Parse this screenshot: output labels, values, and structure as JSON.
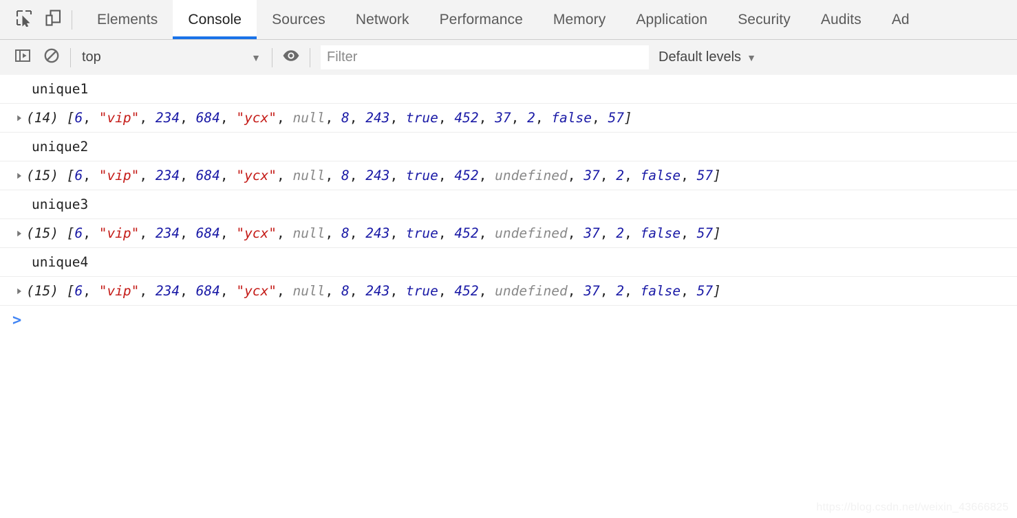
{
  "tabbar": {
    "inspect_icon": "inspect-cursor-icon",
    "device_icon": "device-toolbar-icon",
    "tabs": [
      {
        "label": "Elements",
        "active": false
      },
      {
        "label": "Console",
        "active": true
      },
      {
        "label": "Sources",
        "active": false
      },
      {
        "label": "Network",
        "active": false
      },
      {
        "label": "Performance",
        "active": false
      },
      {
        "label": "Memory",
        "active": false
      },
      {
        "label": "Application",
        "active": false
      },
      {
        "label": "Security",
        "active": false
      },
      {
        "label": "Audits",
        "active": false
      },
      {
        "label": "Ad",
        "active": false
      }
    ]
  },
  "toolbar": {
    "sidebar_toggle_icon": "console-sidebar-icon",
    "clear_console_icon": "clear-console-icon",
    "context_value": "top",
    "context_caret": "▼",
    "eye_icon": "live-expression-eye-icon",
    "filter_placeholder": "Filter",
    "filter_value": "",
    "levels_label": "Default levels",
    "levels_caret": "▼"
  },
  "console": {
    "prompt_symbol": ">",
    "entries": [
      {
        "label": "unique1",
        "count": "(14)",
        "disclosure": "collapsed-triangle-icon",
        "tokens": [
          {
            "t": "[",
            "k": "bracket"
          },
          {
            "t": "6",
            "k": "num"
          },
          {
            "t": ", ",
            "k": "punct"
          },
          {
            "t": "\"vip\"",
            "k": "str"
          },
          {
            "t": ", ",
            "k": "punct"
          },
          {
            "t": "234",
            "k": "num"
          },
          {
            "t": ", ",
            "k": "punct"
          },
          {
            "t": "684",
            "k": "num"
          },
          {
            "t": ", ",
            "k": "punct"
          },
          {
            "t": "\"ycx\"",
            "k": "str"
          },
          {
            "t": ", ",
            "k": "punct"
          },
          {
            "t": "null",
            "k": "nul"
          },
          {
            "t": ", ",
            "k": "punct"
          },
          {
            "t": "8",
            "k": "num"
          },
          {
            "t": ", ",
            "k": "punct"
          },
          {
            "t": "243",
            "k": "num"
          },
          {
            "t": ", ",
            "k": "punct"
          },
          {
            "t": "true",
            "k": "bool"
          },
          {
            "t": ", ",
            "k": "punct"
          },
          {
            "t": "452",
            "k": "num"
          },
          {
            "t": ", ",
            "k": "punct"
          },
          {
            "t": "37",
            "k": "num"
          },
          {
            "t": ", ",
            "k": "punct"
          },
          {
            "t": "2",
            "k": "num"
          },
          {
            "t": ", ",
            "k": "punct"
          },
          {
            "t": "false",
            "k": "bool"
          },
          {
            "t": ", ",
            "k": "punct"
          },
          {
            "t": "57",
            "k": "num"
          },
          {
            "t": "]",
            "k": "bracket"
          }
        ]
      },
      {
        "label": "unique2",
        "count": "(15)",
        "disclosure": "collapsed-triangle-icon",
        "tokens": [
          {
            "t": "[",
            "k": "bracket"
          },
          {
            "t": "6",
            "k": "num"
          },
          {
            "t": ", ",
            "k": "punct"
          },
          {
            "t": "\"vip\"",
            "k": "str"
          },
          {
            "t": ", ",
            "k": "punct"
          },
          {
            "t": "234",
            "k": "num"
          },
          {
            "t": ", ",
            "k": "punct"
          },
          {
            "t": "684",
            "k": "num"
          },
          {
            "t": ", ",
            "k": "punct"
          },
          {
            "t": "\"ycx\"",
            "k": "str"
          },
          {
            "t": ", ",
            "k": "punct"
          },
          {
            "t": "null",
            "k": "nul"
          },
          {
            "t": ", ",
            "k": "punct"
          },
          {
            "t": "8",
            "k": "num"
          },
          {
            "t": ", ",
            "k": "punct"
          },
          {
            "t": "243",
            "k": "num"
          },
          {
            "t": ", ",
            "k": "punct"
          },
          {
            "t": "true",
            "k": "bool"
          },
          {
            "t": ", ",
            "k": "punct"
          },
          {
            "t": "452",
            "k": "num"
          },
          {
            "t": ", ",
            "k": "punct"
          },
          {
            "t": "undefined",
            "k": "nul"
          },
          {
            "t": ", ",
            "k": "punct"
          },
          {
            "t": "37",
            "k": "num"
          },
          {
            "t": ", ",
            "k": "punct"
          },
          {
            "t": "2",
            "k": "num"
          },
          {
            "t": ", ",
            "k": "punct"
          },
          {
            "t": "false",
            "k": "bool"
          },
          {
            "t": ", ",
            "k": "punct"
          },
          {
            "t": "57",
            "k": "num"
          },
          {
            "t": "]",
            "k": "bracket"
          }
        ]
      },
      {
        "label": "unique3",
        "count": "(15)",
        "disclosure": "collapsed-triangle-icon",
        "tokens": [
          {
            "t": "[",
            "k": "bracket"
          },
          {
            "t": "6",
            "k": "num"
          },
          {
            "t": ", ",
            "k": "punct"
          },
          {
            "t": "\"vip\"",
            "k": "str"
          },
          {
            "t": ", ",
            "k": "punct"
          },
          {
            "t": "234",
            "k": "num"
          },
          {
            "t": ", ",
            "k": "punct"
          },
          {
            "t": "684",
            "k": "num"
          },
          {
            "t": ", ",
            "k": "punct"
          },
          {
            "t": "\"ycx\"",
            "k": "str"
          },
          {
            "t": ", ",
            "k": "punct"
          },
          {
            "t": "null",
            "k": "nul"
          },
          {
            "t": ", ",
            "k": "punct"
          },
          {
            "t": "8",
            "k": "num"
          },
          {
            "t": ", ",
            "k": "punct"
          },
          {
            "t": "243",
            "k": "num"
          },
          {
            "t": ", ",
            "k": "punct"
          },
          {
            "t": "true",
            "k": "bool"
          },
          {
            "t": ", ",
            "k": "punct"
          },
          {
            "t": "452",
            "k": "num"
          },
          {
            "t": ", ",
            "k": "punct"
          },
          {
            "t": "undefined",
            "k": "nul"
          },
          {
            "t": ", ",
            "k": "punct"
          },
          {
            "t": "37",
            "k": "num"
          },
          {
            "t": ", ",
            "k": "punct"
          },
          {
            "t": "2",
            "k": "num"
          },
          {
            "t": ", ",
            "k": "punct"
          },
          {
            "t": "false",
            "k": "bool"
          },
          {
            "t": ", ",
            "k": "punct"
          },
          {
            "t": "57",
            "k": "num"
          },
          {
            "t": "]",
            "k": "bracket"
          }
        ]
      },
      {
        "label": "unique4",
        "count": "(15)",
        "disclosure": "collapsed-triangle-icon",
        "tokens": [
          {
            "t": "[",
            "k": "bracket"
          },
          {
            "t": "6",
            "k": "num"
          },
          {
            "t": ", ",
            "k": "punct"
          },
          {
            "t": "\"vip\"",
            "k": "str"
          },
          {
            "t": ", ",
            "k": "punct"
          },
          {
            "t": "234",
            "k": "num"
          },
          {
            "t": ", ",
            "k": "punct"
          },
          {
            "t": "684",
            "k": "num"
          },
          {
            "t": ", ",
            "k": "punct"
          },
          {
            "t": "\"ycx\"",
            "k": "str"
          },
          {
            "t": ", ",
            "k": "punct"
          },
          {
            "t": "null",
            "k": "nul"
          },
          {
            "t": ", ",
            "k": "punct"
          },
          {
            "t": "8",
            "k": "num"
          },
          {
            "t": ", ",
            "k": "punct"
          },
          {
            "t": "243",
            "k": "num"
          },
          {
            "t": ", ",
            "k": "punct"
          },
          {
            "t": "true",
            "k": "bool"
          },
          {
            "t": ", ",
            "k": "punct"
          },
          {
            "t": "452",
            "k": "num"
          },
          {
            "t": ", ",
            "k": "punct"
          },
          {
            "t": "undefined",
            "k": "nul"
          },
          {
            "t": ", ",
            "k": "punct"
          },
          {
            "t": "37",
            "k": "num"
          },
          {
            "t": ", ",
            "k": "punct"
          },
          {
            "t": "2",
            "k": "num"
          },
          {
            "t": ", ",
            "k": "punct"
          },
          {
            "t": "false",
            "k": "bool"
          },
          {
            "t": ", ",
            "k": "punct"
          },
          {
            "t": "57",
            "k": "num"
          },
          {
            "t": "]",
            "k": "bracket"
          }
        ]
      }
    ]
  },
  "watermark": "https://blog.csdn.net/weixin_43666825",
  "colors": {
    "accent": "#1a73e8",
    "number": "#1a1aa6",
    "string": "#c41a16",
    "nullish": "#888888",
    "prompt": "#4285f4",
    "chrome_bg": "#f3f3f3"
  }
}
